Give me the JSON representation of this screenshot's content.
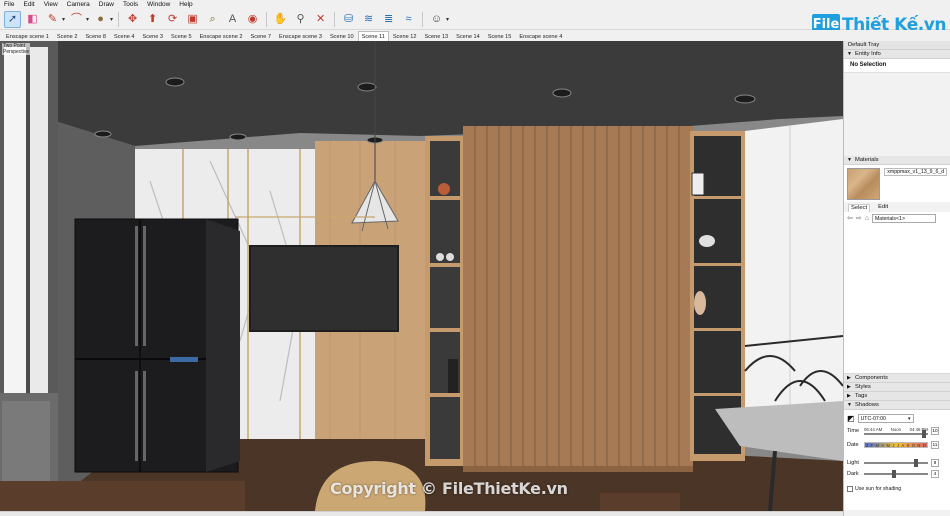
{
  "menu": [
    "File",
    "Edit",
    "View",
    "Camera",
    "Draw",
    "Tools",
    "Window",
    "Help"
  ],
  "toolbar": {
    "tools": [
      {
        "name": "select-tool-icon",
        "glyph": "➚",
        "color": "#2a4d8f",
        "active": true
      },
      {
        "name": "eraser-tool-icon",
        "glyph": "◧",
        "color": "#d84a8a"
      },
      {
        "name": "line-tool-icon",
        "glyph": "✎",
        "color": "#c0392b",
        "caret": true
      },
      {
        "name": "arc-tool-icon",
        "glyph": "⌒",
        "color": "#c0392b",
        "caret": true
      },
      {
        "name": "shape-tool-icon",
        "glyph": "●",
        "color": "#8a6d3b",
        "caret": true
      },
      {
        "name": "move-tool-icon",
        "glyph": "✥",
        "color": "#c0392b"
      },
      {
        "name": "pushpull-tool-icon",
        "glyph": "⬆",
        "color": "#c0392b"
      },
      {
        "name": "rotate-tool-icon",
        "glyph": "⟳",
        "color": "#c0392b"
      },
      {
        "name": "offset-tool-icon",
        "glyph": "▣",
        "color": "#c0392b"
      },
      {
        "name": "tape-measure-icon",
        "glyph": "⌕",
        "color": "#7a6a2a"
      },
      {
        "name": "text-tool-icon",
        "glyph": "A",
        "color": "#555555"
      },
      {
        "name": "paint-bucket-icon",
        "glyph": "◉",
        "color": "#c0392b"
      },
      {
        "name": "orbit-tool-icon",
        "glyph": "✋",
        "color": "#c9a05a"
      },
      {
        "name": "zoom-tool-icon",
        "glyph": "⚲",
        "color": "#555555"
      },
      {
        "name": "zoom-extents-icon",
        "glyph": "✕",
        "color": "#c0392b"
      },
      {
        "name": "warehouse-icon",
        "glyph": "⛁",
        "color": "#2a6fb0"
      },
      {
        "name": "extension-icon",
        "glyph": "≋",
        "color": "#2a6fb0"
      },
      {
        "name": "layers-icon",
        "glyph": "≣",
        "color": "#2a6fb0"
      },
      {
        "name": "sandbox-icon",
        "glyph": "≈",
        "color": "#2a6fb0"
      },
      {
        "name": "account-icon",
        "glyph": "☺",
        "color": "#444444",
        "caret": true
      }
    ]
  },
  "logo": {
    "mark": "File",
    "text": "Thiết Kế.vn"
  },
  "scene_tabs": [
    "Enscape scene 1",
    "Scene 2",
    "Scene 8",
    "Scene 4",
    "Scene 3",
    "Scene 5",
    "Enscape scene 2",
    "Scene 7",
    "Enscape scene 3",
    "Scene 10",
    "Scene 11",
    "Scene 12",
    "Scene 13",
    "Scene 14",
    "Scene 15",
    "Enscape scene 4"
  ],
  "active_scene": "Scene 11",
  "viewport": {
    "camera_label": "Two Point\nPerspective",
    "watermark": "Copyright © FileThietKe.vn"
  },
  "tray": {
    "title": "Default Tray",
    "entity_info": {
      "header": "Entity Info",
      "selection": "No Selection"
    },
    "materials": {
      "header": "Materials",
      "current_name": "xmppmax_v1_13_9_6_d",
      "tabs": [
        "Select",
        "Edit"
      ],
      "active_tab": "Select",
      "collection": "Materials<1>"
    },
    "panels": [
      "Components",
      "Styles",
      "Tags",
      "Shadows"
    ],
    "shadows": {
      "timezone": "UTC-07:00",
      "time_label": "Time",
      "time_ticks": [
        "06:44 AM",
        "Noon",
        "04:46 PM"
      ],
      "time_value": "10",
      "date_label": "Date",
      "months": [
        "J",
        "F",
        "M",
        "A",
        "M",
        "J",
        "J",
        "A",
        "S",
        "O",
        "N",
        "D"
      ],
      "date_value": "11",
      "light_label": "Light",
      "light_value": "8",
      "dark_label": "Dark",
      "dark_value": "4",
      "use_sun_label": "Use sun for shading"
    }
  },
  "colors": {
    "accent": "#1f9fe0",
    "wood": "#a57a55",
    "marble": "#eeeeee",
    "ceiling": "#3a3a3a",
    "fridge": "#1c1c1e"
  }
}
